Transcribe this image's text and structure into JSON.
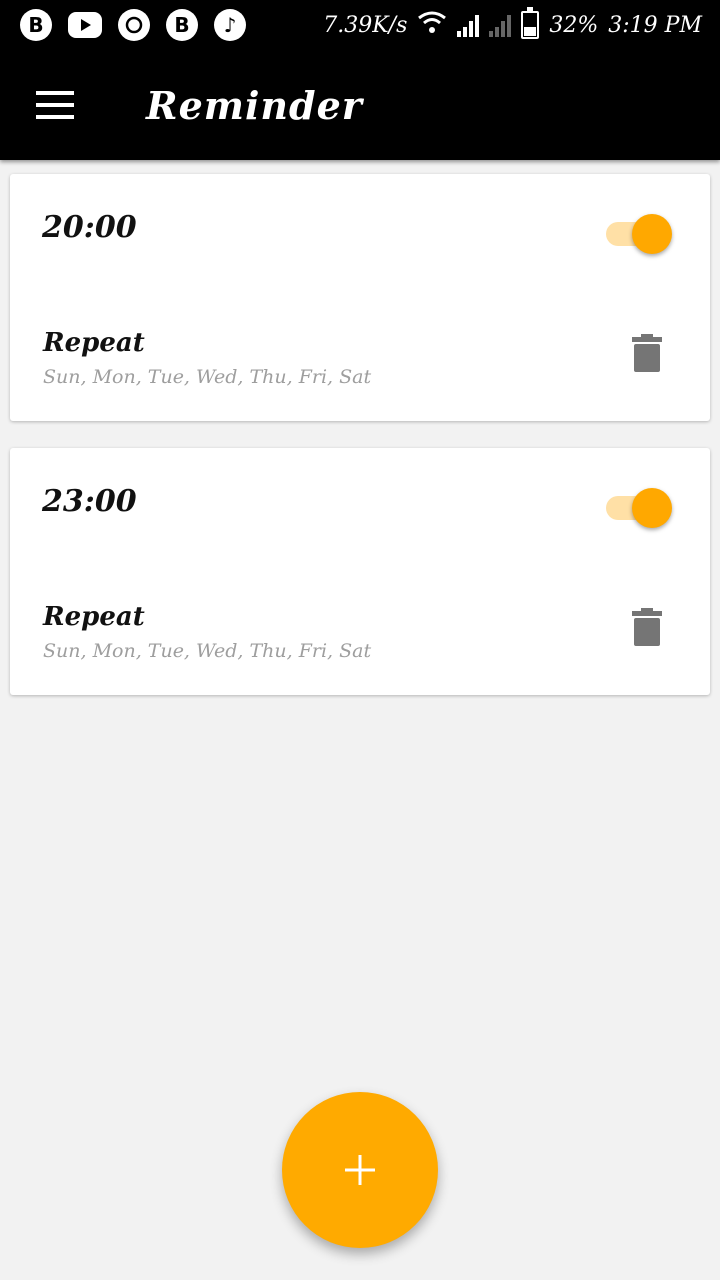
{
  "status_bar": {
    "network_speed": "7.39K/s",
    "battery": "32%",
    "time": "3:19 PM",
    "icons": [
      "b-app-icon",
      "youtube-icon",
      "whatsapp-icon",
      "b-app-icon",
      "music-icon"
    ]
  },
  "app_bar": {
    "title": "Reminder",
    "menu_icon": "hamburger-menu-icon"
  },
  "reminders": [
    {
      "time": "20:00",
      "enabled": true,
      "repeat_label": "Repeat",
      "repeat_days": "Sun, Mon, Tue, Wed, Thu, Fri, Sat"
    },
    {
      "time": "23:00",
      "enabled": true,
      "repeat_label": "Repeat",
      "repeat_days": "Sun, Mon, Tue, Wed, Thu, Fri, Sat"
    }
  ],
  "fab": {
    "icon": "plus-icon"
  },
  "colors": {
    "accent": "#ffa800",
    "toggle_track": "#ffe0a6",
    "bar_bg": "#000000",
    "page_bg": "#f2f2f2",
    "delete_icon": "#757575"
  }
}
